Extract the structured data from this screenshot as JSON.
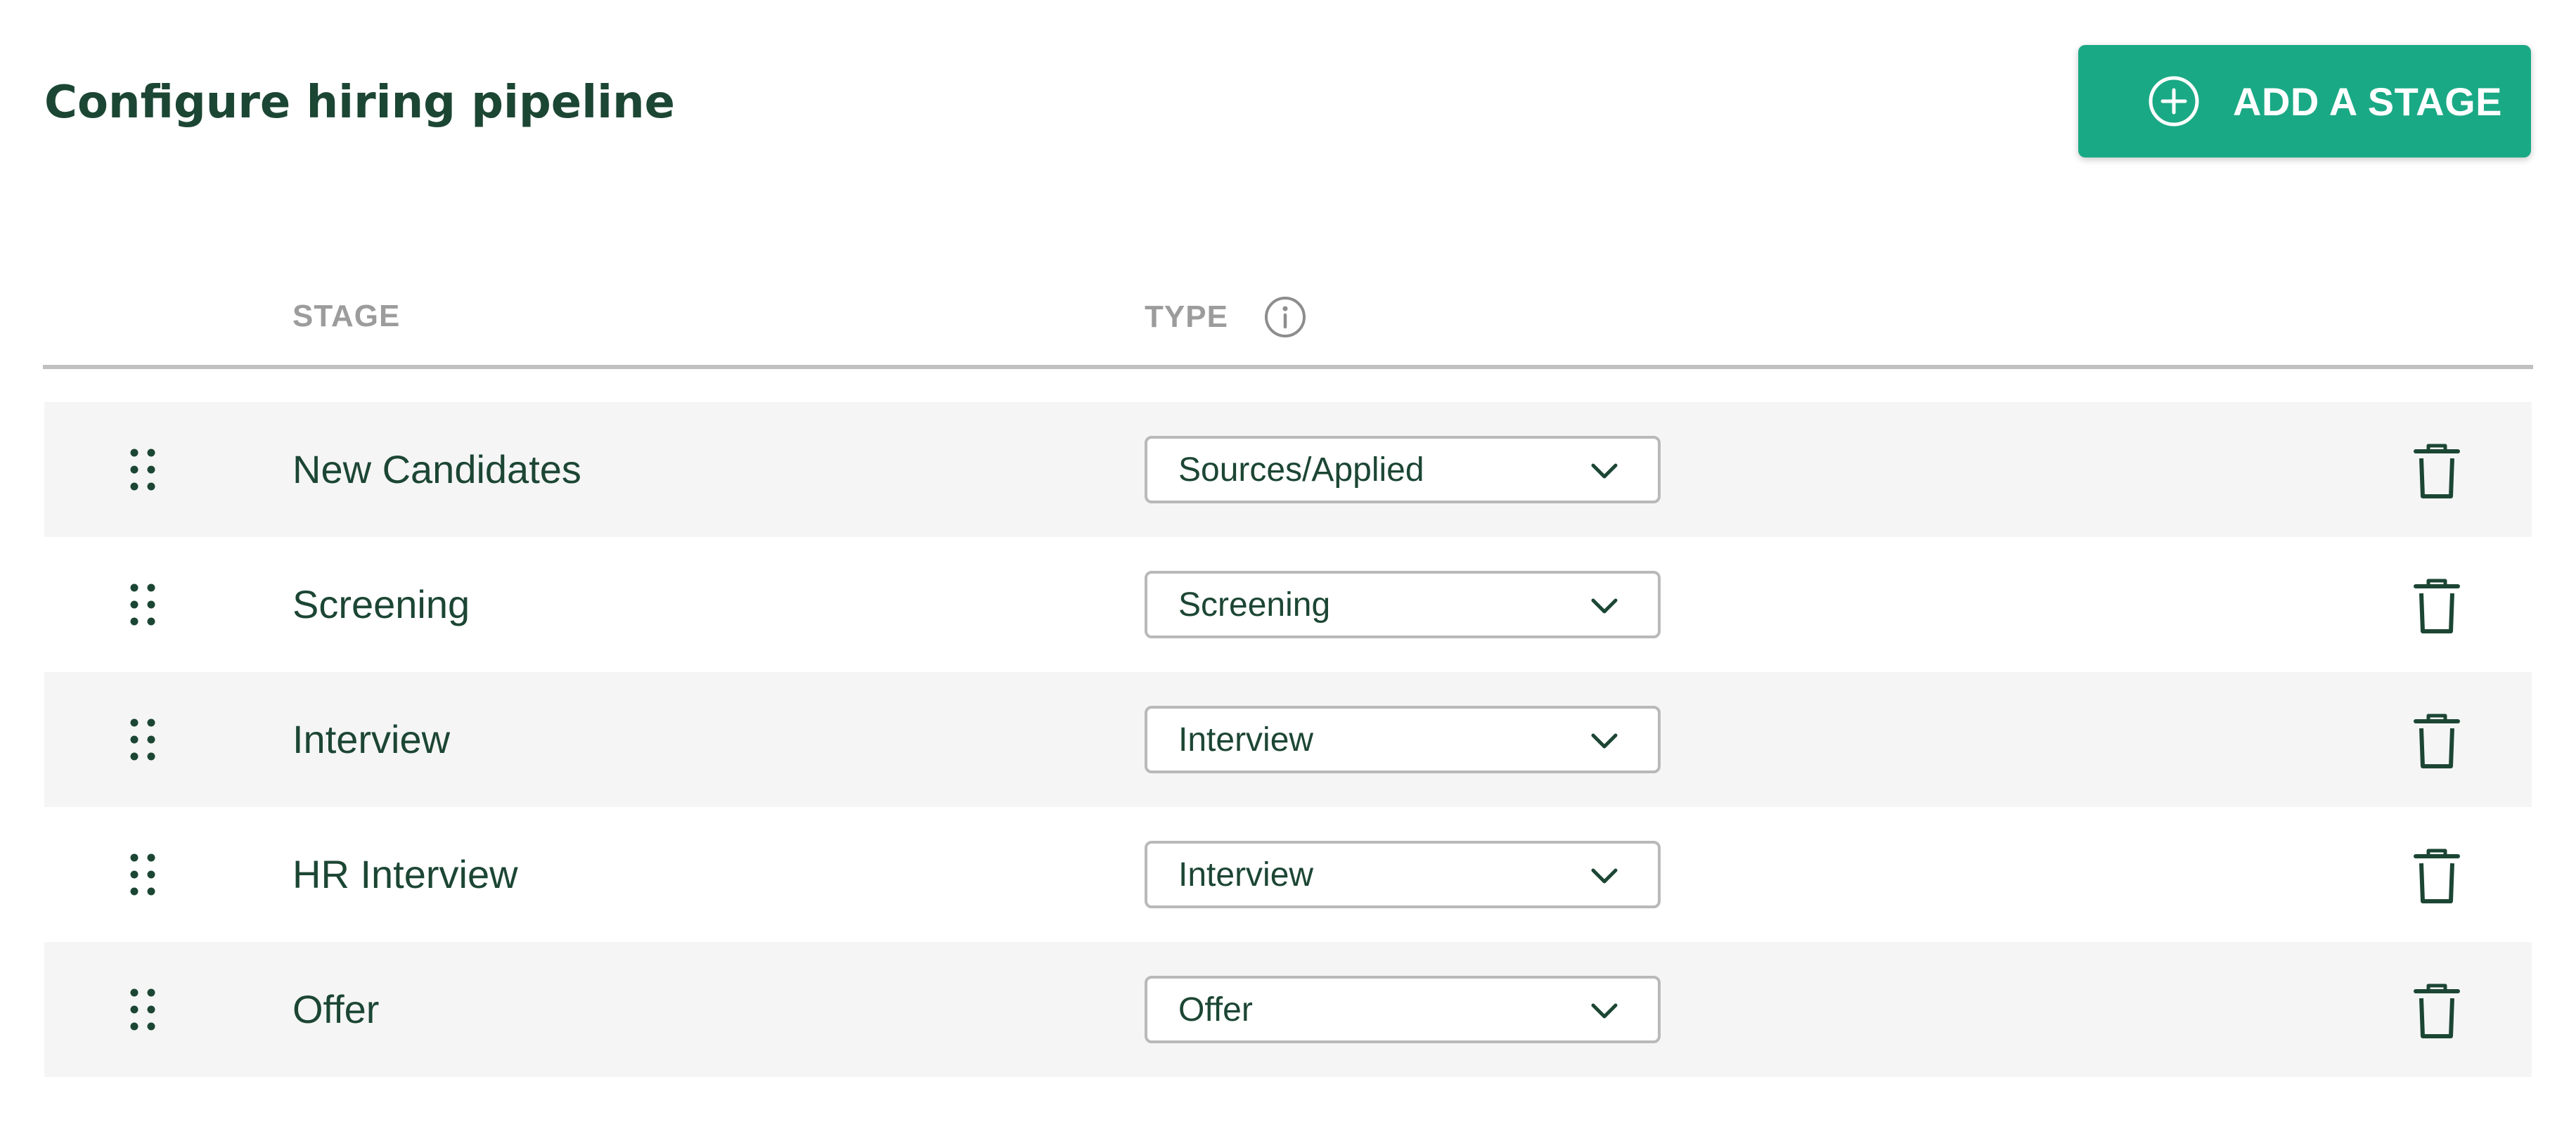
{
  "page": {
    "title": "Configure hiring pipeline"
  },
  "toolbar": {
    "add_stage_label": "ADD A STAGE",
    "add_stage_icon": "plus-circle-icon"
  },
  "table": {
    "headers": {
      "stage": "STAGE",
      "type": "TYPE",
      "type_info_icon": "info-icon"
    },
    "rows": [
      {
        "stage": "New Candidates",
        "type": "Sources/Applied"
      },
      {
        "stage": "Screening",
        "type": "Screening"
      },
      {
        "stage": "Interview",
        "type": "Interview"
      },
      {
        "stage": "HR Interview",
        "type": "Interview"
      },
      {
        "stage": "Offer",
        "type": "Offer"
      }
    ]
  },
  "icons": {
    "drag_handle": "drag-handle-icon",
    "dropdown": "chevron-down-icon",
    "delete": "trash-icon"
  },
  "colors": {
    "primary": "#1aa985",
    "text_dark": "#1c4634",
    "header_gray": "#9c9c9c",
    "row_shade": "#f5f5f5",
    "border_gray": "#b9b9b9"
  }
}
